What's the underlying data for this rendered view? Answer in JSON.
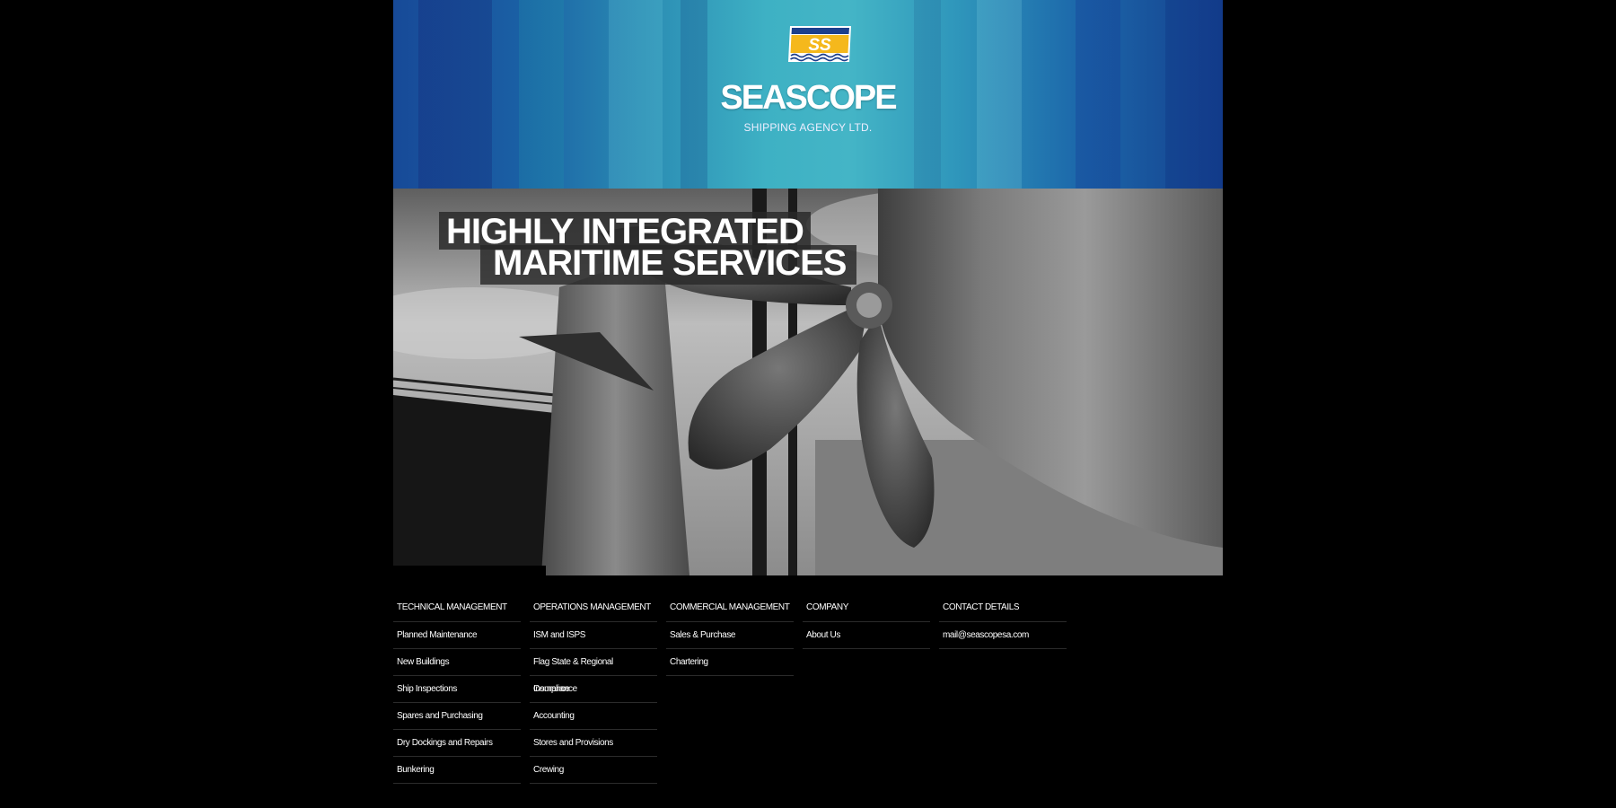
{
  "header": {
    "brand_name": "SEASCOPE",
    "brand_subtitle": "SHIPPING AGENCY LTD.",
    "logo_letters": "SS",
    "colors": {
      "blue": "#1a5aa8",
      "cyan": "#3eb1c4",
      "logo_yellow": "#f5b81c"
    }
  },
  "hero": {
    "headline_line1": "HIGHLY INTEGRATED",
    "headline_line2": "MARITIME SERVICES",
    "image": "ship-propeller-photo"
  },
  "nav": {
    "columns": [
      {
        "title": "TECHNICAL MANAGEMENT",
        "items": [
          "Planned Maintenance",
          "New Buildings",
          "Ship Inspections",
          "Spares and Purchasing",
          "Dry Dockings and Repairs",
          "Bunkering"
        ]
      },
      {
        "title": "OPERATIONS MANAGEMENT",
        "items": [
          "ISM and ISPS",
          "Flag State & Regional Compliance",
          "Insurance",
          "Accounting",
          "Stores and Provisions",
          "Crewing"
        ]
      },
      {
        "title": "COMMERCIAL MANAGEMENT",
        "items": [
          "Sales & Purchase",
          "Chartering"
        ]
      },
      {
        "title": "COMPANY",
        "items": [
          "About Us"
        ]
      },
      {
        "title": "CONTACT DETAILS",
        "items": [
          "mail@seascopesa.com"
        ]
      }
    ]
  }
}
